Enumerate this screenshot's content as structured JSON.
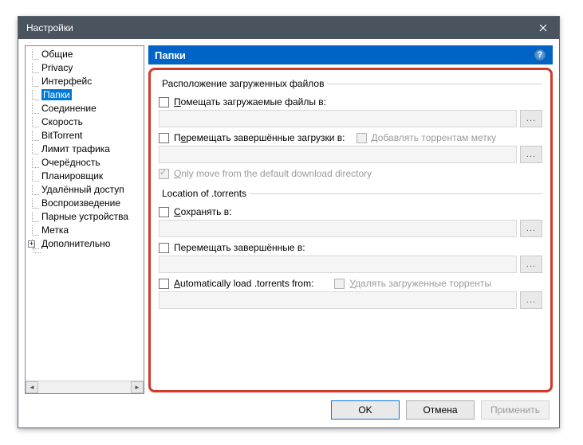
{
  "window": {
    "title": "Настройки"
  },
  "header": {
    "title": "Папки"
  },
  "sidebar": {
    "items": [
      "Общие",
      "Privacy",
      "Интерфейс",
      "Папки",
      "Соединение",
      "Скорость",
      "BitTorrent",
      "Лимит трафика",
      "Очерёдность",
      "Планировщик",
      "Удалённый доступ",
      "Воспроизведение",
      "Парные устройства",
      "Метка",
      "Дополнительно"
    ],
    "selected_index": 3
  },
  "section1": {
    "legend": "Расположение загруженных файлов",
    "put_label": "Помещать загружаемые файлы в:",
    "move_label": "Перемещать завершённые загрузки в:",
    "add_label_label": "Добавлять торрентам метку",
    "only_move_label": "Only move from the default download directory"
  },
  "section2": {
    "legend": "Location of .torrents",
    "save_label": "Сохранять в:",
    "move_done_label": "Перемещать завершённые в:",
    "autoload_label": "Automatically load .torrents from:",
    "delete_loaded_label": "Удалять загруженные торренты"
  },
  "browse_label": "...",
  "buttons": {
    "ok": "OK",
    "cancel": "Отмена",
    "apply": "Применить"
  }
}
